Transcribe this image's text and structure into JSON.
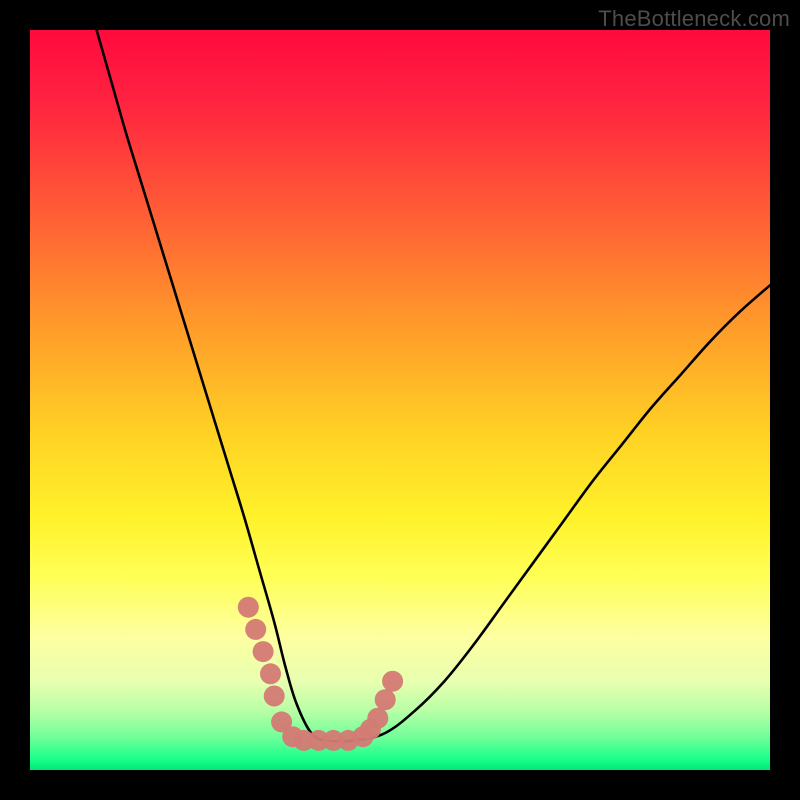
{
  "watermark": "TheBottleneck.com",
  "chart_data": {
    "type": "line",
    "title": "",
    "xlabel": "",
    "ylabel": "",
    "xlim": [
      0,
      100
    ],
    "ylim": [
      0,
      100
    ],
    "series": [
      {
        "name": "bottleneck-curve",
        "x": [
          9,
          11,
          13,
          15,
          17,
          19,
          21,
          23,
          25,
          27,
          29,
          31,
          33,
          34.5,
          36,
          38,
          40,
          44,
          48,
          52,
          56,
          60,
          64,
          68,
          72,
          76,
          80,
          84,
          88,
          92,
          96,
          100
        ],
        "y": [
          100,
          93,
          86,
          79.5,
          73,
          66.5,
          60,
          53.5,
          47,
          40.5,
          34,
          27,
          20,
          14,
          9,
          5,
          4,
          4,
          5,
          8,
          12,
          17,
          22.5,
          28,
          33.5,
          39,
          44,
          49,
          53.5,
          58,
          62,
          65.5
        ]
      },
      {
        "name": "highlight-dots",
        "x": [
          29.5,
          30.5,
          31.5,
          32.5,
          33,
          34,
          35.5,
          37,
          39,
          41,
          43,
          45,
          46,
          47,
          48,
          49
        ],
        "y": [
          22,
          19,
          16,
          13,
          10,
          6.5,
          4.5,
          4,
          4,
          4,
          4,
          4.5,
          5.5,
          7,
          9.5,
          12
        ]
      }
    ],
    "gradient_stops": [
      {
        "offset": 0.0,
        "color": "#ff0a3e"
      },
      {
        "offset": 0.1,
        "color": "#ff2440"
      },
      {
        "offset": 0.24,
        "color": "#ff5a36"
      },
      {
        "offset": 0.4,
        "color": "#ff9b2a"
      },
      {
        "offset": 0.55,
        "color": "#ffd324"
      },
      {
        "offset": 0.66,
        "color": "#fff22b"
      },
      {
        "offset": 0.74,
        "color": "#ffff57"
      },
      {
        "offset": 0.82,
        "color": "#fdffa1"
      },
      {
        "offset": 0.88,
        "color": "#e8ffb0"
      },
      {
        "offset": 0.92,
        "color": "#b8ffa6"
      },
      {
        "offset": 0.955,
        "color": "#72ff9a"
      },
      {
        "offset": 0.985,
        "color": "#1aff8a"
      },
      {
        "offset": 1.0,
        "color": "#00e876"
      }
    ],
    "colors": {
      "curve": "#000000",
      "dots": "#d47a74",
      "background_frame": "#000000"
    }
  }
}
